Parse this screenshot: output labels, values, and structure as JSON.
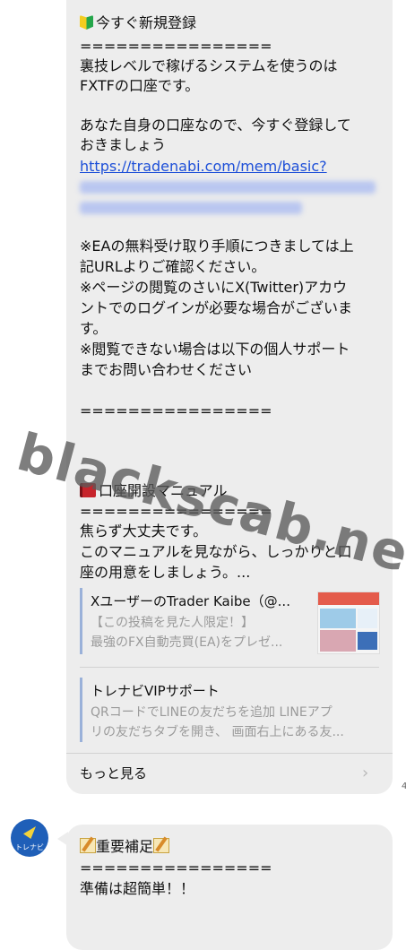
{
  "message1": {
    "heading": "今すぐ新規登録",
    "separator": "================",
    "line1": "裏技レベルで稼げるシステムを使うのは",
    "line2": "FXTFの口座です。",
    "line3": "あなた自身の口座なので、今すぐ登録して",
    "line4": "おきましょう",
    "link": "https://tradenabi.com/mem/basic?",
    "note1a": "※EAの無料受け取り手順につきましては上",
    "note1b": "記URLよりご確認ください。",
    "note2a": "※ページの閲覧のさいにX(Twitter)アカウ",
    "note2b": "ントでのログインが必要な場合がございま",
    "note2c": "す。",
    "note3a": "※閲覧できない場合は以下の個人サポート",
    "note3b": "までお問い合わせください",
    "separator2": "================",
    "manual_heading": "口座開設マニュアル",
    "separator3": "================",
    "manual1": "焦らず大丈夫です。",
    "manual2": "このマニュアルを見ながら、しっかりと口",
    "manual3": "座の用意をしましょう。...",
    "card1": {
      "title": "XユーザーのTrader Kaibe（@...",
      "desc1": "【この投稿を見た人限定！】",
      "desc2": "最強のFX自動売買(EA)をプレゼ..."
    },
    "card2": {
      "title": "トレナビVIPサポート",
      "desc1": "QRコードでLINEの友だちを追加 LINEアプ",
      "desc2": "リの友だちタブを開き、 画面右上にある友..."
    },
    "more_label": "もっと見る",
    "chevron": "›",
    "side_mark": "4"
  },
  "message2": {
    "avatar_label": "トレナビ",
    "heading": "重要補足",
    "separator": "================",
    "line1": "準備は超簡単！！"
  },
  "watermark": "blackscab.net",
  "icons": {
    "beginner": "beginner-mark-icon",
    "book": "red-book-icon",
    "memo": "memo-icon"
  },
  "colors": {
    "bubble": "#ededed",
    "link": "#1d4fd8",
    "avatar": "#1f5fb8"
  }
}
